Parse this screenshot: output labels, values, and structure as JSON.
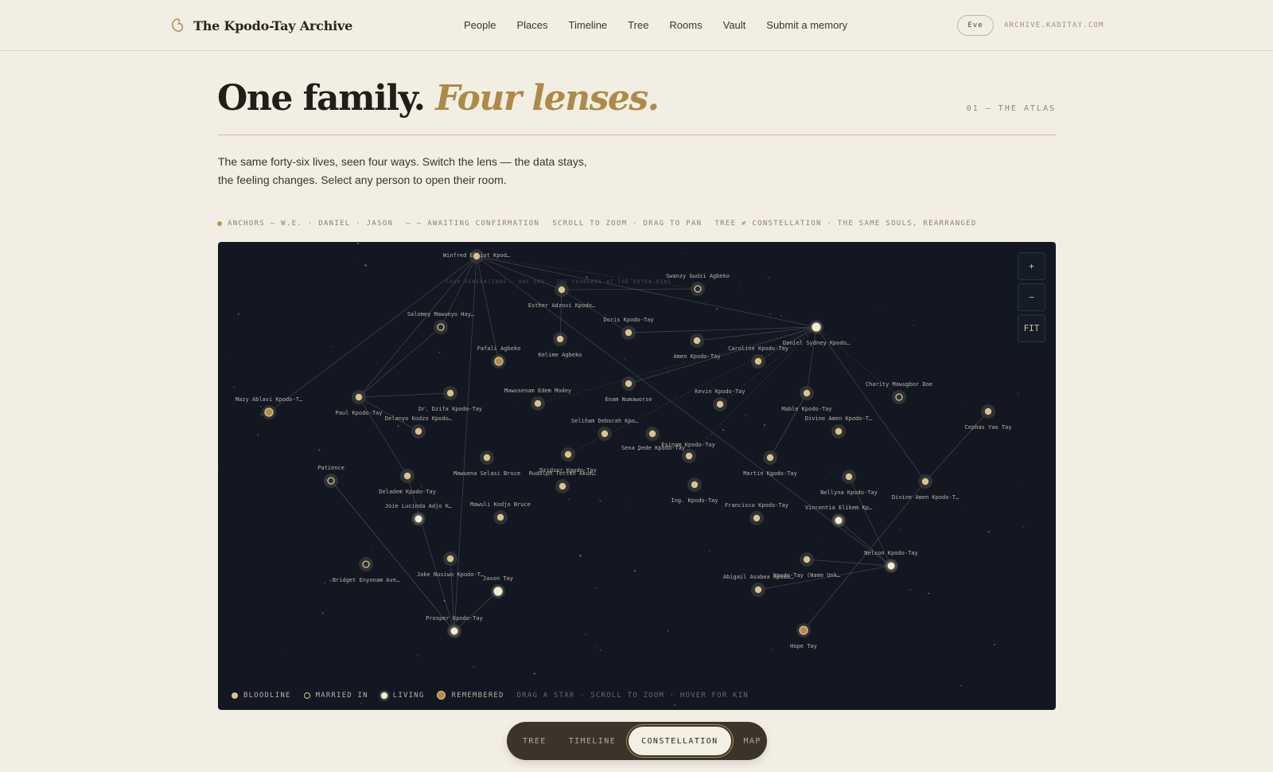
{
  "header": {
    "brand": "The Kpodo-Tay Archive",
    "nav": [
      "People",
      "Places",
      "Timeline",
      "Tree",
      "Rooms",
      "Vault",
      "Submit a memory"
    ],
    "user": "Eve",
    "domain": "ARCHIVE.KADITAY.COM"
  },
  "hero": {
    "title_plain": "One family.",
    "title_accent": "Four lenses.",
    "section_tag": "01 — THE ATLAS",
    "intro": "The same forty-six lives, seen four ways. Switch the lens — the data stays, the feeling changes. Select any person to open their room."
  },
  "legend_line": {
    "anchors": "ANCHORS — W.E. · DANIEL · JASON",
    "awaiting": "— — AWAITING CONFIRMATION",
    "controls": "SCROLL TO ZOOM · DRAG TO PAN",
    "note": "TREE ≠ CONSTELLATION · THE SAME SOULS, REARRANGED"
  },
  "sky": {
    "banner": "FOUR GENERATIONS · ONE SKY · THE FOUNDERS AT THE OUTER RING",
    "zoom_in": "+",
    "zoom_out": "−",
    "fit": "FIT",
    "colors": {
      "background": "#121722",
      "bloodline": "#d8c58e",
      "remembered": "#b88a4a",
      "living": "#f3ecd4",
      "married": "#2a2f38"
    },
    "stars": [
      {
        "id": "winfred",
        "name": "Winfred Elliot Kpod…",
        "type": "bloodline"
      },
      {
        "id": "swanzy",
        "name": "Swanzy Gudzi Agbeko",
        "type": "married"
      },
      {
        "id": "esther",
        "name": "Esther Adzovi Kpodo…",
        "type": "bloodline"
      },
      {
        "id": "salomey",
        "name": "Salomey Mawunyo Hay…",
        "type": "married"
      },
      {
        "id": "doris",
        "name": "Doris Kpodo-Tay",
        "type": "bloodline"
      },
      {
        "id": "daniel",
        "name": "Daniel Sydney Kpodo…",
        "type": "living"
      },
      {
        "id": "fafali",
        "name": "Fafali Agbeko",
        "type": "remembered"
      },
      {
        "id": "kelime",
        "name": "Kelime Agbeko",
        "type": "bloodline"
      },
      {
        "id": "amen",
        "name": "Amen Kpodo-Tay",
        "type": "bloodline"
      },
      {
        "id": "caroline",
        "name": "Caroline Kpodo-Tay",
        "type": "bloodline"
      },
      {
        "id": "charity",
        "name": "Charity Mawugbor Doe",
        "type": "married"
      },
      {
        "id": "mazy",
        "name": "Mazy Ablavi Kpodo-T…",
        "type": "remembered"
      },
      {
        "id": "paul",
        "name": "Paul Kpodo-Tay",
        "type": "bloodline"
      },
      {
        "id": "drzifa",
        "name": "Dr. Dzifa Kpodo-Tay",
        "type": "bloodline"
      },
      {
        "id": "mawusenam",
        "name": "Mawusenam Edem Modey",
        "type": "bloodline"
      },
      {
        "id": "enam",
        "name": "Enam Numaworse",
        "type": "bloodline"
      },
      {
        "id": "kevin",
        "name": "Kevin Kpodo-Tay",
        "type": "bloodline"
      },
      {
        "id": "mable",
        "name": "Mable Kpodo-Tay",
        "type": "bloodline"
      },
      {
        "id": "cephas",
        "name": "Cephas Yao Tay",
        "type": "bloodline"
      },
      {
        "id": "delanyo",
        "name": "Delanyo Kodzo Kpodo…",
        "type": "bloodline"
      },
      {
        "id": "divine1",
        "name": "Divine Amen Kpodo-T…",
        "type": "bloodline"
      },
      {
        "id": "selinam",
        "name": "Selinam Deborah Kpo…",
        "type": "bloodline"
      },
      {
        "id": "esinam",
        "name": "Esinam Kpodo-Tay",
        "type": "bloodline"
      },
      {
        "id": "sena",
        "name": "Sena Dede Kpodo-Tay",
        "type": "bloodline"
      },
      {
        "id": "patience",
        "name": "Patience",
        "type": "married"
      },
      {
        "id": "mawuena",
        "name": "Mawuena Selasi Bruce",
        "type": "bloodline"
      },
      {
        "id": "dzidzor",
        "name": "Dzidzor Kpodo-Tay",
        "type": "bloodline"
      },
      {
        "id": "rudolph",
        "name": "Rudolph Tetteh Akum…",
        "type": "bloodline"
      },
      {
        "id": "martin",
        "name": "Martin Kpodo-Tay",
        "type": "bloodline"
      },
      {
        "id": "deladem",
        "name": "Deladem Kpodo-Tay",
        "type": "bloodline"
      },
      {
        "id": "nellyna",
        "name": "Nellyna Kpodo-Tay",
        "type": "bloodline"
      },
      {
        "id": "divine2",
        "name": "Divine Amen Kpodo-T…",
        "type": "bloodline"
      },
      {
        "id": "ing",
        "name": "Ing. Kpodo-Tay",
        "type": "bloodline"
      },
      {
        "id": "joie",
        "name": "Joie Lucinda Adjo K…",
        "type": "living"
      },
      {
        "id": "mawuli",
        "name": "Mawuli Kodjo Bruce",
        "type": "bloodline"
      },
      {
        "id": "francisco",
        "name": "Francisco Kpodo-Tay",
        "type": "bloodline"
      },
      {
        "id": "vincentia",
        "name": "Vincentia Elikem Kp…",
        "type": "living"
      },
      {
        "id": "nelson",
        "name": "Nelson Kpodo-Tay",
        "type": "living"
      },
      {
        "id": "bridget",
        "name": "Bridget Enyonam Ave…",
        "type": "married"
      },
      {
        "id": "jake",
        "name": "Jake Nusiwo Kpodo-T…",
        "type": "bloodline"
      },
      {
        "id": "jason",
        "name": "Jason Tay",
        "type": "living"
      },
      {
        "id": "abigail",
        "name": "Abigail Asabea Kpodo…",
        "type": "bloodline"
      },
      {
        "id": "kpodotay",
        "name": "Kpodo-Tay (Name Unk…",
        "type": "bloodline"
      },
      {
        "id": "prosper",
        "name": "Prosper Kpodo-Tay",
        "type": "living"
      },
      {
        "id": "hope",
        "name": "Hope Tay",
        "type": "remembered"
      }
    ],
    "legend": {
      "bloodline": "BLOODLINE",
      "married": "MARRIED IN",
      "living": "LIVING",
      "remembered": "REMEMBERED",
      "hint": "DRAG A STAR · SCROLL TO ZOOM · HOVER FOR KIN"
    }
  },
  "lens": {
    "options": [
      "TREE",
      "TIMELINE",
      "CONSTELLATION",
      "MAP"
    ],
    "active": "CONSTELLATION"
  }
}
